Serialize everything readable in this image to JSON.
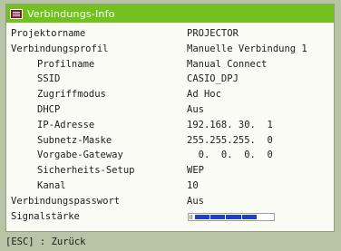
{
  "window": {
    "title": "Verbindungs-Info",
    "title_icon": "info-list-icon"
  },
  "rows": [
    {
      "label": "Projektorname",
      "value": "PROJECTOR",
      "indent": 0
    },
    {
      "label": "Verbindungsprofil",
      "value": "Manuelle Verbindung 1",
      "indent": 0
    },
    {
      "label": "Profilname",
      "value": "Manual Connect",
      "indent": 1
    },
    {
      "label": "SSID",
      "value": "CASIO_DPJ",
      "indent": 1
    },
    {
      "label": "Zugriffmodus",
      "value": "Ad Hoc",
      "indent": 1
    },
    {
      "label": "DHCP",
      "value": "Aus",
      "indent": 1
    },
    {
      "label": "IP-Adresse",
      "value": "192.168. 30.  1",
      "indent": 1
    },
    {
      "label": "Subnetz-Maske",
      "value": "255.255.255.  0",
      "indent": 1
    },
    {
      "label": "Vorgabe-Gateway",
      "value": "  0.  0.  0.  0",
      "indent": 1
    },
    {
      "label": "Sicherheits-Setup",
      "value": "WEP",
      "indent": 1
    },
    {
      "label": "Kanal",
      "value": "10",
      "indent": 1
    },
    {
      "label": "Verbindungspasswort",
      "value": "Aus",
      "indent": 0
    }
  ],
  "signal": {
    "label": "Signalstärke",
    "level": 0.8,
    "segments_total": 5,
    "segments_on": 4,
    "bar_color": "#1c3fd0"
  },
  "footer": {
    "hint": "[ESC] : Zurück"
  },
  "colors": {
    "titlebar": "#72c11e",
    "panel": "#fbfbf6",
    "background": "#b8c4a6"
  }
}
